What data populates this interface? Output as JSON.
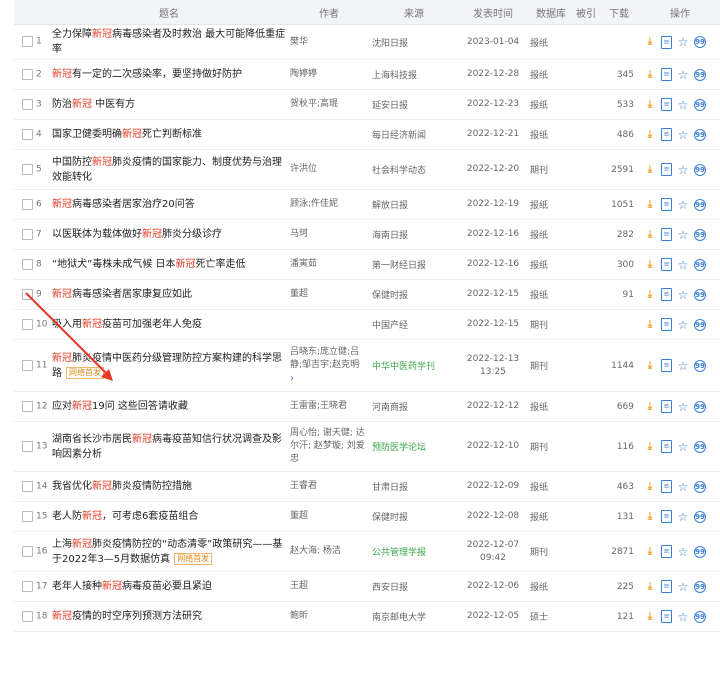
{
  "headers": {
    "title": "题名",
    "author": "作者",
    "source": "来源",
    "date": "发表时间",
    "db": "数据库",
    "ref": "被引",
    "download": "下载",
    "ops": "操作"
  },
  "rows": [
    {
      "num": "1",
      "pre": "全力保障",
      "hl": "新冠",
      "post": "病毒感染者及时救治 最大可能降低重症率",
      "author": "樊华",
      "source": "沈阳日报",
      "date": "2023-01-04",
      "db": "报纸",
      "dl": ""
    },
    {
      "num": "2",
      "pre": "",
      "hl": "新冠",
      "post": "有一定的二次感染率，要坚持做好防护",
      "author": "陶婷婷",
      "source": "上海科技报",
      "date": "2022-12-28",
      "db": "报纸",
      "dl": "345"
    },
    {
      "num": "3",
      "pre": "防治",
      "hl": "新冠",
      "post": " 中医有方",
      "author": "贺秋平;高琨",
      "source": "延安日报",
      "date": "2022-12-23",
      "db": "报纸",
      "dl": "533"
    },
    {
      "num": "4",
      "pre": "国家卫健委明确",
      "hl": "新冠",
      "post": "死亡判断标准",
      "author": "",
      "source": "每日经济新闻",
      "date": "2022-12-21",
      "db": "报纸",
      "dl": "486"
    },
    {
      "num": "5",
      "pre": "中国防控",
      "hl": "新冠",
      "post": "肺炎疫情的国家能力、制度优势与治理效能转化",
      "author": "许洪位",
      "source": "社会科学动态",
      "date": "2022-12-20",
      "db": "期刊",
      "dl": "2591"
    },
    {
      "num": "6",
      "pre": "",
      "hl": "新冠",
      "post": "病毒感染者居家治疗20问答",
      "author": "顾泳;仵佳妮",
      "source": "解放日报",
      "date": "2022-12-19",
      "db": "报纸",
      "dl": "1051"
    },
    {
      "num": "7",
      "pre": "以医联体为载体做好",
      "hl": "新冠",
      "post": "肺炎分级诊疗",
      "author": "马珂",
      "source": "海南日报",
      "date": "2022-12-16",
      "db": "报纸",
      "dl": "282"
    },
    {
      "num": "8",
      "pre": "“地狱犬”毒株未成气候 日本",
      "hl": "新冠",
      "post": "死亡率走低",
      "author": "潘寅茹",
      "source": "第一财经日报",
      "date": "2022-12-16",
      "db": "报纸",
      "dl": "300"
    },
    {
      "num": "9",
      "pre": "",
      "hl": "新冠",
      "post": "病毒感染者居家康复应如此",
      "author": "董超",
      "source": "保健时报",
      "date": "2022-12-15",
      "db": "报纸",
      "dl": "91"
    },
    {
      "num": "10",
      "pre": "吸入用",
      "hl": "新冠",
      "post": "疫苗可加强老年人免疫",
      "author": "",
      "source": "中国产经",
      "date": "2022-12-15",
      "db": "期刊",
      "dl": ""
    },
    {
      "num": "11",
      "pre": "",
      "hl": "新冠",
      "post": "肺炎疫情中医药分级管理防控方案构建的科学思路",
      "tag": "网络首发",
      "author": "吕晓东;庞立健;吕静;邹吉宇;赵克明",
      "more": true,
      "source": "中华中医药学刊",
      "green": true,
      "date": "2022-12-13 13:25",
      "db": "期刊",
      "dl": "1144"
    },
    {
      "num": "12",
      "pre": "应对",
      "hl": "新冠",
      "post": "19问 这些回答请收藏",
      "author": "王雷雷;王晓君",
      "source": "河南商报",
      "date": "2022-12-12",
      "db": "报纸",
      "dl": "669"
    },
    {
      "num": "13",
      "pre": "湖南省长沙市居民",
      "hl": "新冠",
      "post": "病毒疫苗知信行状况调查及影响因素分析",
      "author": "周心怡; 谢天健; 达尔汗; 赵梦璇; 刘爱忠",
      "source": "预防医学论坛",
      "green": true,
      "date": "2022-12-10",
      "db": "期刊",
      "dl": "116"
    },
    {
      "num": "14",
      "pre": "我省优化",
      "hl": "新冠",
      "post": "肺炎疫情防控措施",
      "author": "王睿君",
      "source": "甘肃日报",
      "date": "2022-12-09",
      "db": "报纸",
      "dl": "463"
    },
    {
      "num": "15",
      "pre": "老人防",
      "hl": "新冠",
      "post": "，可考虑6套疫苗组合",
      "author": "董超",
      "source": "保健时报",
      "date": "2022-12-08",
      "db": "报纸",
      "dl": "131"
    },
    {
      "num": "16",
      "pre": "上海",
      "hl": "新冠",
      "post": "肺炎疫情防控的“动态清零”政策研究——基于2022年3—5月数据仿真",
      "tag": "网络首发",
      "author": "赵大海; 杨洁",
      "source": "公共管理学报",
      "green": true,
      "date": "2022-12-07 09:42",
      "db": "期刊",
      "dl": "2871"
    },
    {
      "num": "17",
      "pre": "老年人接种",
      "hl": "新冠",
      "post": "病毒疫苗必要且紧迫",
      "author": "王超",
      "source": "西安日报",
      "date": "2022-12-06",
      "db": "报纸",
      "dl": "225"
    },
    {
      "num": "18",
      "pre": "",
      "hl": "新冠",
      "post": "疫情的时空序列预测方法研究",
      "author": "鲍昕",
      "source": "南京邮电大学",
      "date": "2022-12-05",
      "db": "硕士",
      "dl": "121"
    }
  ],
  "colors": {
    "highlight": "#e0351d",
    "annotation_arrow": "#e8392a",
    "op_icon": "#3b7fd8",
    "download_icon": "#f0a020"
  },
  "icons": {
    "download": "download-icon",
    "read": "html-read-icon",
    "favorite": "star-icon",
    "cite": "cite-icon"
  }
}
